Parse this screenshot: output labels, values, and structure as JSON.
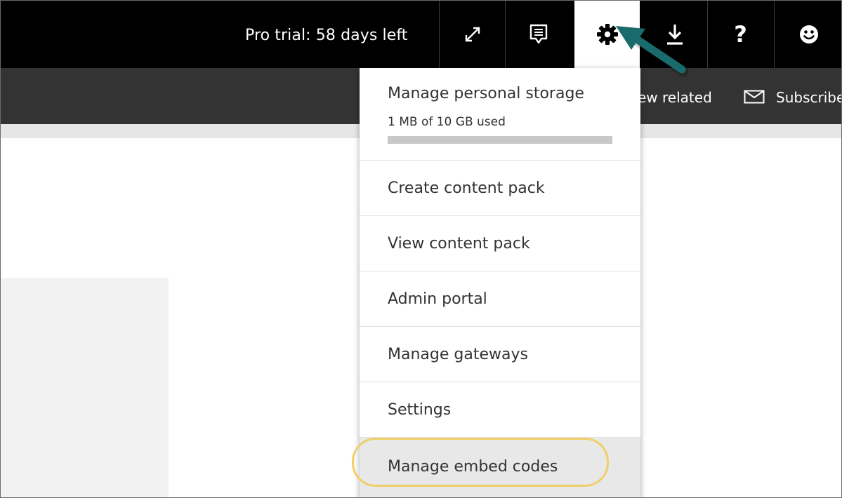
{
  "topbar": {
    "trial_text": "Pro trial: 58 days left",
    "icons": [
      "expand-icon",
      "feedback-icon",
      "gear-icon",
      "download-icon",
      "help-icon",
      "smiley-icon"
    ],
    "help_glyph": "?"
  },
  "subbar": {
    "view_related_label": "ew related",
    "subscribe_label": "Subscribe"
  },
  "settings_menu": {
    "storage": {
      "title": "Manage personal storage",
      "usage": "1 MB of 10 GB used",
      "used_fraction": 0.0001
    },
    "items": [
      {
        "label": "Create content pack"
      },
      {
        "label": "View content pack"
      },
      {
        "label": "Admin portal"
      },
      {
        "label": "Manage gateways"
      },
      {
        "label": "Settings"
      },
      {
        "label": "Manage embed codes"
      }
    ]
  },
  "colors": {
    "topbar": "#000000",
    "subbar": "#333333",
    "arrow": "#1a6b6b",
    "highlight": "#f1cf68"
  }
}
